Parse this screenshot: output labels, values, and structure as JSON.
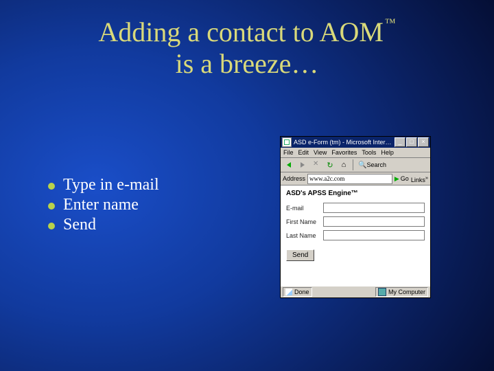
{
  "title": {
    "line1_before_tm": "Adding a contact to AOM",
    "tm": "™",
    "line2": "is a breeze…"
  },
  "bullets": [
    "Type in e-mail",
    "Enter name",
    "Send"
  ],
  "screenshot": {
    "titlebar": "ASD e-Form (tm) - Microsoft Inter…",
    "win_buttons": {
      "min": "_",
      "max": "□",
      "close": "×"
    },
    "menu": [
      "File",
      "Edit",
      "View",
      "Favorites",
      "Tools",
      "Help"
    ],
    "toolbar": {
      "search_label": "Search"
    },
    "address": {
      "label": "Address",
      "value": "www.a2c.com",
      "go": "Go",
      "links": "Links",
      "links_sup": "»"
    },
    "page": {
      "heading": "ASD's APSS Engine™",
      "fields": [
        {
          "label": "E-mail"
        },
        {
          "label": "First Name"
        },
        {
          "label": "Last Name"
        }
      ],
      "send": "Send"
    },
    "status": {
      "done": "Done",
      "zone": "My Computer"
    }
  }
}
